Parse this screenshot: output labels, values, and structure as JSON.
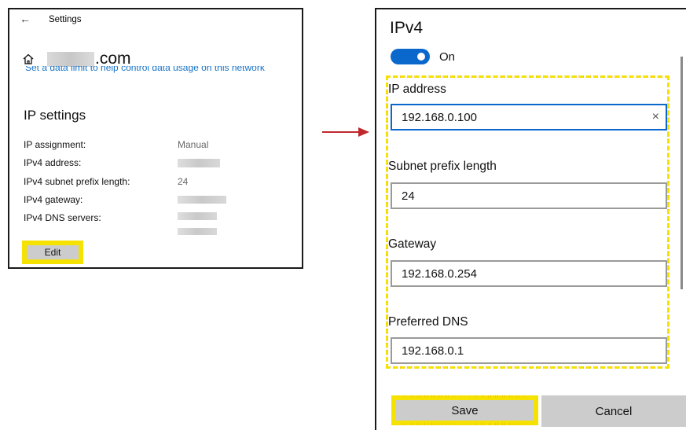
{
  "left": {
    "back_glyph": "←",
    "window_title": "Settings",
    "domain_suffix": ".com",
    "data_limit_link": "Set a data limit to help control data usage on this network",
    "section_title": "IP settings",
    "rows": [
      {
        "label": "IP assignment:",
        "value": "Manual"
      },
      {
        "label": "IPv4 address:",
        "value": ""
      },
      {
        "label": "IPv4 subnet prefix length:",
        "value": "24"
      },
      {
        "label": "IPv4 gateway:",
        "value": ""
      },
      {
        "label": "IPv4 DNS servers:",
        "value": ""
      }
    ],
    "edit_label": "Edit"
  },
  "right": {
    "title": "IPv4",
    "toggle_label": "On",
    "toggle_on": true,
    "fields": [
      {
        "label": "IP address",
        "value": "192.168.0.100"
      },
      {
        "label": "Subnet prefix length",
        "value": "24"
      },
      {
        "label": "Gateway",
        "value": "192.168.0.254"
      },
      {
        "label": "Preferred DNS",
        "value": "192.168.0.1"
      }
    ],
    "clear_glyph": "×",
    "save_label": "Save",
    "cancel_label": "Cancel"
  },
  "colors": {
    "accent": "#0a67cc",
    "link": "#1672c6",
    "highlight_dash_red": "#d40000",
    "highlight_dash_yellow": "#f5e200",
    "arrow": "#c0282d",
    "button_bg": "#cccccc"
  },
  "icons": [
    "back-arrow-icon",
    "home-icon",
    "clear-icon",
    "arrow-icon"
  ]
}
